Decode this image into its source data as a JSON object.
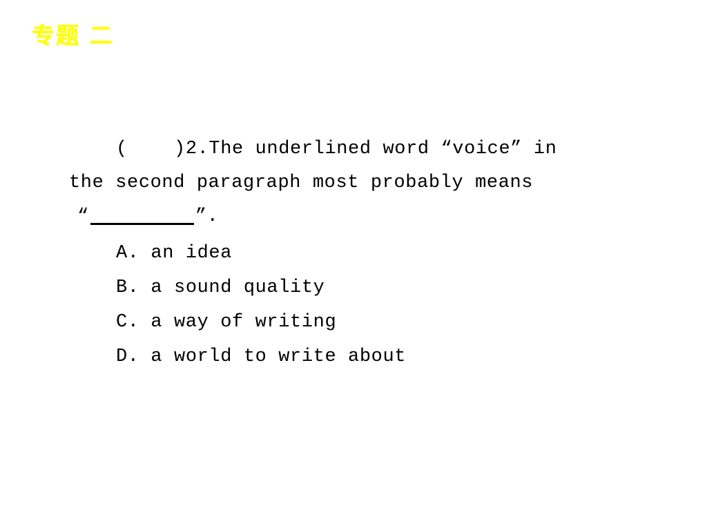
{
  "slide": {
    "title": "专题 二",
    "title_color": "#FFFF00",
    "background_color": "#FFFFFF",
    "text_color": "#000000"
  },
  "question": {
    "number": "2",
    "bracket_prefix": "(    )2.",
    "line_1": "(    )2.The underlined word “voice” in",
    "line_2": "the second paragraph most probably means",
    "line_3_open_quote": "“",
    "line_3_close_quote": "”",
    "line_3_period": ".",
    "stem_full": "(    )2.The underlined word “voice” in the second paragraph most probably means “________”."
  },
  "options": [
    {
      "letter": "A.",
      "text": "an idea",
      "full": "A. an idea"
    },
    {
      "letter": "B.",
      "text": "a sound quality",
      "full": "B. a sound quality"
    },
    {
      "letter": "C.",
      "text": "a way of writing",
      "full": "C. a way of writing"
    },
    {
      "letter": "D.",
      "text": "a world to write about",
      "full": "D. a world to write about"
    }
  ]
}
